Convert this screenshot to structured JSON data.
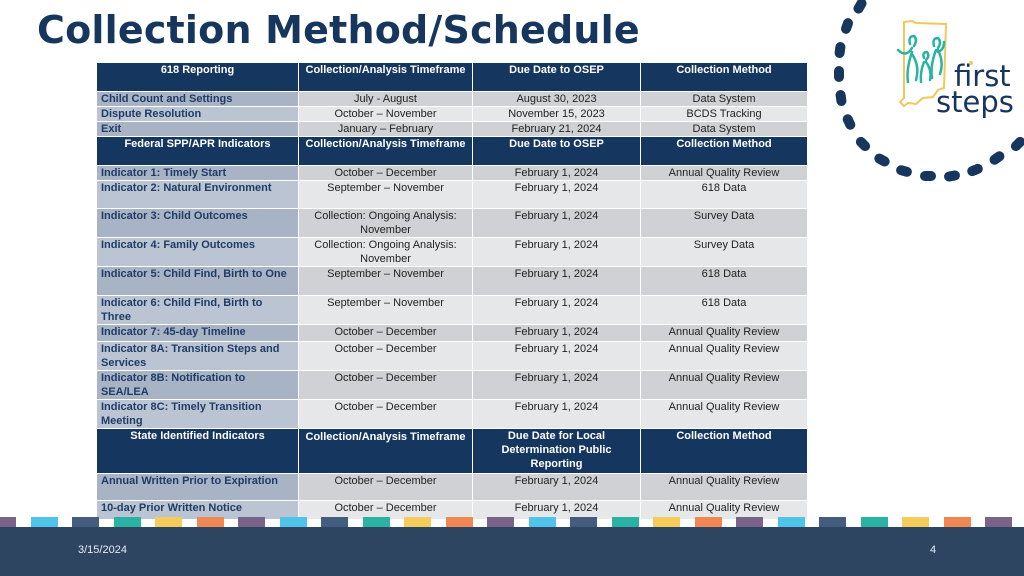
{
  "title": "Collection Method/Schedule",
  "logo": {
    "line1": "first",
    "line2": "steps",
    "colors": {
      "navy": "#17365d",
      "teal": "#2ab3a4",
      "gold": "#f0c95a"
    }
  },
  "table": {
    "sections": [
      {
        "header": [
          "618 Reporting",
          "Collection/Analysis Timeframe",
          "Due Date to OSEP",
          "Collection Method"
        ],
        "rows": [
          [
            "Child Count and Settings",
            "July - August",
            "August 30, 2023",
            "Data System"
          ],
          [
            "Dispute Resolution",
            "October – November",
            "November 15, 2023",
            "BCDS Tracking"
          ],
          [
            "Exit",
            "January – February",
            "February 21, 2024",
            "Data System"
          ]
        ]
      },
      {
        "header": [
          "Federal SPP/APR Indicators",
          "Collection/Analysis Timeframe",
          "Due Date to OSEP",
          "Collection Method"
        ],
        "rows": [
          [
            "Indicator 1: Timely Start",
            "October – December",
            "February 1, 2024",
            "Annual Quality Review"
          ],
          [
            "Indicator 2: Natural Environment",
            "September – November",
            "February 1, 2024",
            "618 Data"
          ],
          [
            "Indicator 3: Child Outcomes",
            "Collection: Ongoing Analysis: November",
            "February 1, 2024",
            "Survey Data"
          ],
          [
            "Indicator 4: Family Outcomes",
            "Collection: Ongoing Analysis: November",
            "February 1, 2024",
            "Survey Data"
          ],
          [
            "Indicator 5: Child Find, Birth to One",
            "September – November",
            "February 1, 2024",
            "618 Data"
          ],
          [
            "Indicator 6: Child Find, Birth to Three",
            "September – November",
            "February 1, 2024",
            "618 Data"
          ],
          [
            "Indicator 7: 45-day Timeline",
            "October – December",
            "February 1, 2024",
            "Annual Quality Review"
          ],
          [
            "Indicator 8A: Transition Steps and Services",
            "October – December",
            "February 1, 2024",
            "Annual Quality Review"
          ],
          [
            "Indicator 8B: Notification to SEA/LEA",
            "October – December",
            "February 1, 2024",
            "Annual Quality Review"
          ],
          [
            "Indicator 8C: Timely Transition Meeting",
            "October – December",
            "February 1, 2024",
            "Annual Quality Review"
          ]
        ]
      },
      {
        "header": [
          "State Identified Indicators",
          "Collection/Analysis Timeframe",
          "Due Date for Local Determination Public Reporting",
          "Collection Method"
        ],
        "rows": [
          [
            "Annual Written Prior to Expiration",
            "October – December",
            "February 1, 2024",
            "Annual Quality Review"
          ],
          [
            "10-day Prior Written Notice",
            "October – December",
            "February 1, 2024",
            "Annual Quality Review"
          ]
        ]
      }
    ]
  },
  "stripe_colors": [
    "#7a6389",
    "#4fc3ea",
    "#445c7e",
    "#2ab3a4",
    "#f5cc5c",
    "#f08752"
  ],
  "footer": {
    "date": "3/15/2024",
    "page": "4"
  }
}
